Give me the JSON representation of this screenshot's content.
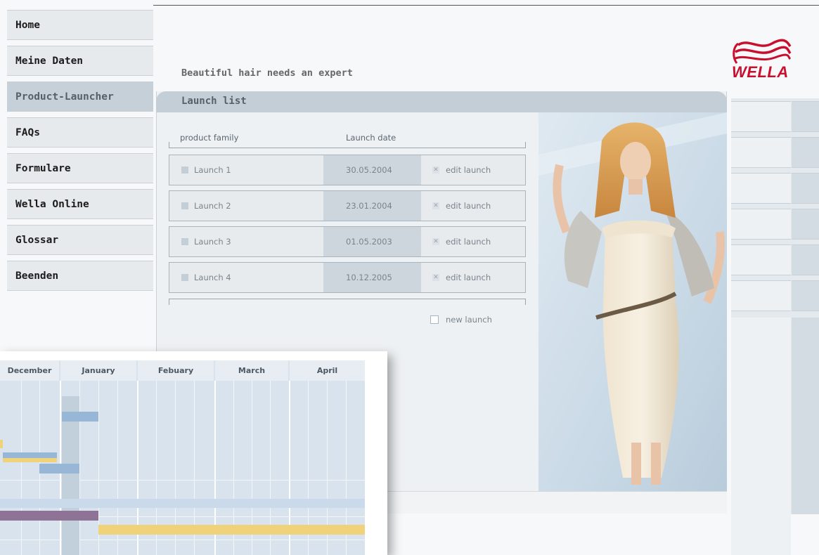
{
  "nav": {
    "items": [
      {
        "label": "Home"
      },
      {
        "label": "Meine Daten"
      },
      {
        "label": "Product-Launcher"
      },
      {
        "label": "FAQs"
      },
      {
        "label": "Formulare"
      },
      {
        "label": "Wella Online"
      },
      {
        "label": "Glossar"
      },
      {
        "label": "Beenden"
      }
    ],
    "active_index": 2
  },
  "header": {
    "tagline": "Beautiful hair needs an expert",
    "logo_text": "WELLA"
  },
  "launch_list": {
    "title": "Launch list",
    "columns": {
      "product_family": "product family",
      "launch_date": "Launch date"
    },
    "rows": [
      {
        "name": "Launch 1",
        "date": "30.05.2004",
        "action": "edit launch"
      },
      {
        "name": "Launch 2",
        "date": "23.01.2004",
        "action": "edit launch"
      },
      {
        "name": "Launch 3",
        "date": "01.05.2003",
        "action": "edit launch"
      },
      {
        "name": "Launch 4",
        "date": "10.12.2005",
        "action": "edit launch"
      }
    ],
    "new_launch_label": "new launch"
  },
  "calendar": {
    "months": [
      "December",
      "January",
      "Febuary",
      "March",
      "April"
    ]
  },
  "colors": {
    "brand": "#c8102e",
    "panel_header": "#c3ced6",
    "bar_blue": "#98b6d6",
    "bar_yellow": "#f0d27a",
    "bar_purple": "#8e7396"
  },
  "icons": {
    "logo": "wella-wave-icon",
    "row_marker": "square-icon",
    "edit": "x-box-icon",
    "new": "checkbox-icon"
  }
}
